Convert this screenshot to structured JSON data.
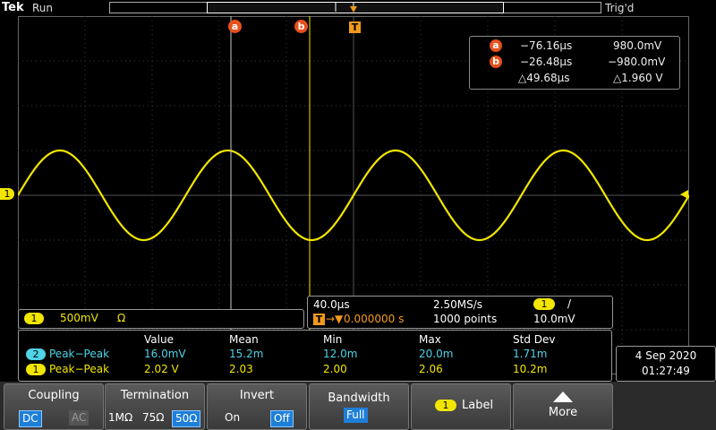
{
  "topbar": {
    "brand": "Tek",
    "run_state": "Run",
    "trigger_state": "Trig'd"
  },
  "colors": {
    "ch1": "#f2e600",
    "ch2": "#4fd3e8",
    "cursor": "#e8501c",
    "trigger": "#f29a1c",
    "selected": "#1e7fd8"
  },
  "markers": {
    "cursor_a": "a",
    "cursor_b": "b",
    "trigger": "T",
    "ch1": "1",
    "ch2": "2"
  },
  "cursors": {
    "a_time": "−76.16µs",
    "a_value": "980.0mV",
    "b_time": "−26.48µs",
    "b_value": "−980.0mV",
    "delta_time": "△49.68µs",
    "delta_value": "△1.960 V"
  },
  "waveform": {
    "channel": "1",
    "cycles_visible": 4,
    "amplitude_divs": 2.0,
    "phase_start": "zero-rising"
  },
  "channel_bar": {
    "channel": "1",
    "scale": "500mV",
    "termination_symbol": "Ω"
  },
  "horizontal": {
    "timebase": "40.0µs",
    "sample_rate": "2.50MS/s",
    "trig_channel": "1",
    "trig_slope": "/",
    "delay_prefix": "→▼",
    "delay": "0.000000 s",
    "record_length": "1000 points",
    "trig_level": "10.0mV"
  },
  "measurements": {
    "headers": [
      "Value",
      "Mean",
      "Min",
      "Max",
      "Std Dev"
    ],
    "rows": [
      {
        "channel": "2",
        "name": "Peak−Peak",
        "values": [
          "16.0mV",
          "15.2m",
          "12.0m",
          "20.0m",
          "1.71m"
        ]
      },
      {
        "channel": "1",
        "name": "Peak−Peak",
        "values": [
          "2.02 V",
          "2.03",
          "2.00",
          "2.06",
          "10.2m"
        ]
      }
    ]
  },
  "datetime": {
    "date": "4 Sep 2020",
    "time": "01:27:49"
  },
  "menu": {
    "coupling": {
      "title": "Coupling",
      "opt_dc": "DC",
      "opt_ac": "AC"
    },
    "termination": {
      "title": "Termination",
      "opt_1m": "1MΩ",
      "opt_75": "75Ω",
      "opt_50": "50Ω"
    },
    "invert": {
      "title": "Invert",
      "opt_on": "On",
      "opt_off": "Off"
    },
    "bandwidth": {
      "title": "Bandwidth",
      "value": "Full"
    },
    "label": {
      "channel": "1",
      "title": "Label"
    },
    "more": {
      "title": "More"
    }
  }
}
